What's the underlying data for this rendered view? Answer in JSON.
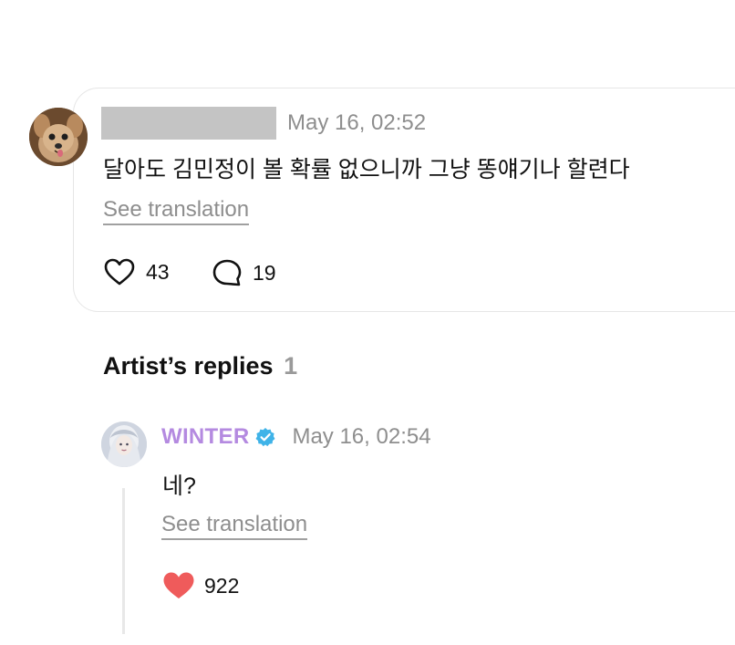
{
  "post": {
    "timestamp": "May 16, 02:52",
    "text": "달아도 김민정이 볼 확률 없으니까 그냥 똥얘기나 할련다",
    "translate_label": "See translation",
    "like_count": "43",
    "comment_count": "19",
    "avatar_icon": "dog-avatar"
  },
  "artist_replies": {
    "title": "Artist’s replies",
    "count": "1",
    "reply": {
      "author": "WINTER",
      "verified_icon": "verified-badge-icon",
      "timestamp": "May 16, 02:54",
      "text": "네?",
      "translate_label": "See translation",
      "like_count": "922"
    }
  },
  "colors": {
    "artist_name": "#b48ae0",
    "verified_badge": "#3fb3e8",
    "liked_heart": "#ef5b5b",
    "muted_text": "#8e8e8e"
  }
}
